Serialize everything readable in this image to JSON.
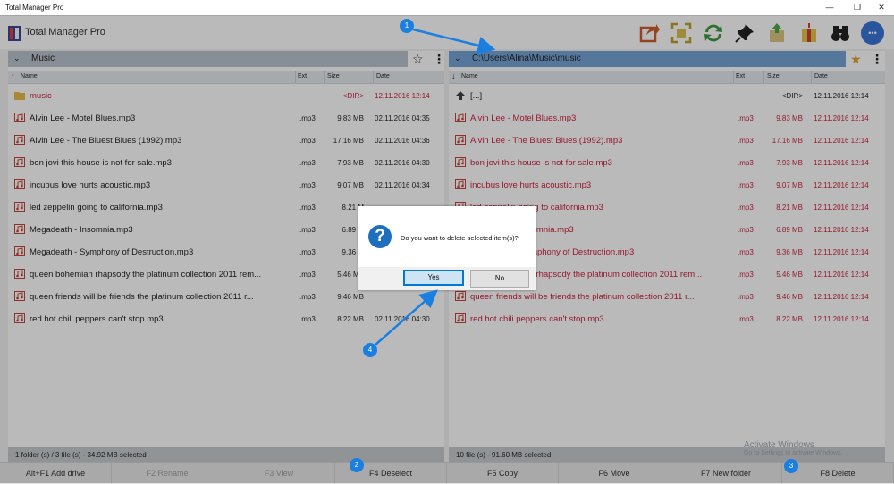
{
  "window": {
    "title": "Total Manager Pro",
    "minimize": "—",
    "maximize": "❐",
    "close": "✕"
  },
  "app": {
    "name": "Total Manager Pro",
    "toolbar_icons": [
      "share-icon",
      "select-frame-icon",
      "refresh-icon",
      "pin-icon",
      "upload-icon",
      "download-icon",
      "binoculars-icon",
      "more-icon"
    ],
    "more_glyph": "•••"
  },
  "left_panel": {
    "path": "Music",
    "chevron": "⌄",
    "sort_arrow": "↑",
    "star": "☆",
    "menu": "⋮",
    "columns": {
      "name": "Name",
      "ext": "Ext",
      "size": "Size",
      "date": "Date"
    },
    "rows": [
      {
        "name": "music",
        "ext": "",
        "size": "<DIR>",
        "date": "12.11.2016 12:14",
        "type": "folder",
        "red": true
      },
      {
        "name": "Alvin Lee - Motel Blues.mp3",
        "ext": ".mp3",
        "size": "9.83 MB",
        "date": "02.11.2016 04:35",
        "type": "audio",
        "red": false
      },
      {
        "name": "Alvin Lee - The Bluest Blues (1992).mp3",
        "ext": ".mp3",
        "size": "17.16 MB",
        "date": "02.11.2016 04:36",
        "type": "audio",
        "red": false
      },
      {
        "name": "bon jovi this house is not for sale.mp3",
        "ext": ".mp3",
        "size": "7.93 MB",
        "date": "02.11.2016 04:30",
        "type": "audio",
        "red": false
      },
      {
        "name": "incubus love hurts acoustic.mp3",
        "ext": ".mp3",
        "size": "9.07 MB",
        "date": "02.11.2016 04:34",
        "type": "audio",
        "red": false
      },
      {
        "name": "led zeppelin going to california.mp3",
        "ext": ".mp3",
        "size": "8.21 M",
        "date": "",
        "type": "audio",
        "red": false
      },
      {
        "name": "Megadeath - Insomnia.mp3",
        "ext": ".mp3",
        "size": "6.89 M",
        "date": "",
        "type": "audio",
        "red": false
      },
      {
        "name": "Megadeath - Symphony of Destruction.mp3",
        "ext": ".mp3",
        "size": "9.36 M",
        "date": "",
        "type": "audio",
        "red": false
      },
      {
        "name": "queen bohemian rhapsody the platinum collection 2011 rem...",
        "ext": ".mp3",
        "size": "5.46 MB",
        "date": "",
        "type": "audio",
        "red": false
      },
      {
        "name": "queen friends will be friends the platinum collection 2011 r...",
        "ext": ".mp3",
        "size": "9.46 MB",
        "date": "",
        "type": "audio",
        "red": false
      },
      {
        "name": "red hot chili peppers can't stop.mp3",
        "ext": ".mp3",
        "size": "8.22 MB",
        "date": "02.11.2016 04:30",
        "type": "audio",
        "red": false
      }
    ],
    "status": "1 folder (s) / 3 file (s) - 34.92 MB selected"
  },
  "right_panel": {
    "path": "C:\\Users\\Alina\\Music\\music",
    "chevron": "⌄",
    "sort_arrow": "↓",
    "star": "★",
    "menu": "⋮",
    "columns": {
      "name": "Name",
      "ext": "Ext",
      "size": "Size",
      "date": "Date"
    },
    "rows": [
      {
        "name": "[...]",
        "ext": "",
        "size": "<DIR>",
        "date": "12.11.2016 12:14",
        "type": "up",
        "red": false
      },
      {
        "name": "Alvin Lee - Motel Blues.mp3",
        "ext": ".mp3",
        "size": "9.83 MB",
        "date": "12.11.2016 12:14",
        "type": "audio",
        "red": true
      },
      {
        "name": "Alvin Lee - The Bluest Blues (1992).mp3",
        "ext": ".mp3",
        "size": "17.16 MB",
        "date": "12.11.2016 12:14",
        "type": "audio",
        "red": true
      },
      {
        "name": "bon jovi this house is not for sale.mp3",
        "ext": ".mp3",
        "size": "7.93 MB",
        "date": "12.11.2016 12:14",
        "type": "audio",
        "red": true
      },
      {
        "name": "incubus love hurts acoustic.mp3",
        "ext": ".mp3",
        "size": "9.07 MB",
        "date": "12.11.2016 12:14",
        "type": "audio",
        "red": true
      },
      {
        "name": "led zeppelin going to california.mp3",
        "ext": ".mp3",
        "size": "8.21 MB",
        "date": "12.11.2016 12:14",
        "type": "audio",
        "red": true
      },
      {
        "name": "Megadeath - Insomnia.mp3",
        "ext": ".mp3",
        "size": "6.89 MB",
        "date": "12.11.2016 12:14",
        "type": "audio",
        "red": true
      },
      {
        "name": "Megadeath - Symphony of Destruction.mp3",
        "ext": ".mp3",
        "size": "9.36 MB",
        "date": "12.11.2016 12:14",
        "type": "audio",
        "red": true
      },
      {
        "name": "queen bohemian rhapsody the platinum collection 2011 rem...",
        "ext": ".mp3",
        "size": "5.46 MB",
        "date": "12.11.2016 12:14",
        "type": "audio",
        "red": true
      },
      {
        "name": "queen friends will be friends the platinum collection 2011 r...",
        "ext": ".mp3",
        "size": "9.46 MB",
        "date": "12.11.2016 12:14",
        "type": "audio",
        "red": true
      },
      {
        "name": "red hot chili peppers can't stop.mp3",
        "ext": ".mp3",
        "size": "8.22 MB",
        "date": "12.11.2016 12:14",
        "type": "audio",
        "red": true
      }
    ],
    "status": "10 file (s) - 91.60 MB selected"
  },
  "fkeys": [
    {
      "label": "Alt+F1  Add drive",
      "disabled": false
    },
    {
      "label": "F2  Rename",
      "disabled": true
    },
    {
      "label": "F3  View",
      "disabled": true
    },
    {
      "label": "F4  Deselect",
      "disabled": false
    },
    {
      "label": "F5  Copy",
      "disabled": false
    },
    {
      "label": "F6  Move",
      "disabled": false
    },
    {
      "label": "F7  New folder",
      "disabled": false
    },
    {
      "label": "F8  Delete",
      "disabled": false
    }
  ],
  "watermark": {
    "line1": "Activate Windows",
    "line2": "Go to Settings to activate Windows."
  },
  "dialog": {
    "icon": "?",
    "message": "Do you want to delete selected item(s)?",
    "yes": "Yes",
    "no": "No"
  },
  "callouts": [
    "1",
    "2",
    "3",
    "4"
  ],
  "colors": {
    "accent": "#1a7fe0",
    "selected_red": "#c8102e",
    "active_path": "#6b9dd3",
    "inactive_path": "#b6bec9"
  }
}
